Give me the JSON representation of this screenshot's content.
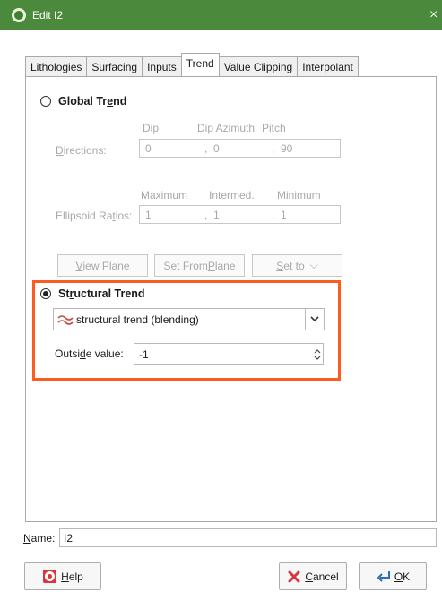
{
  "window": {
    "title": "Edit I2",
    "close_glyph": "×"
  },
  "tabs": [
    "Lithologies",
    "Surfacing",
    "Inputs",
    "Trend",
    "Value Clipping",
    "Interpolant"
  ],
  "active_tab": "Trend",
  "global_trend": {
    "label_pre": "Global Tr",
    "label_u": "e",
    "label_post": "nd",
    "directions": {
      "label_u": "D",
      "label_post": "irections:",
      "headers": [
        "Dip",
        "Dip Azimuth",
        "Pitch"
      ],
      "values": [
        "0",
        "0",
        "90"
      ],
      "sep": ","
    },
    "ellipsoid": {
      "label_pre": "Ellipsoid Ra",
      "label_u": "t",
      "label_post": "ios:",
      "headers": [
        "Maximum",
        "Intermed.",
        "Minimum"
      ],
      "values": [
        "1",
        "1",
        "1"
      ],
      "sep": ","
    },
    "buttons": {
      "view_plane_u": "V",
      "view_plane_post": "iew Plane",
      "set_from_plane_pre": "Set From ",
      "set_from_plane_u": "P",
      "set_from_plane_post": "lane",
      "set_to_u": "S",
      "set_to_post": "et to",
      "chevron": "⌵"
    }
  },
  "structural_trend": {
    "label_pre": "St",
    "label_u": "r",
    "label_post": "uctural Trend",
    "selected": "structural trend (blending)",
    "outside_label_pre": "Outsi",
    "outside_label_u": "d",
    "outside_label_post": "e value:",
    "outside_value": "-1"
  },
  "name": {
    "label_u": "N",
    "label_post": "ame:",
    "value": "I2"
  },
  "buttons": {
    "help_u": "H",
    "help_post": "elp",
    "cancel_u": "C",
    "cancel_post": "ancel",
    "ok_u": "O",
    "ok_post": "K"
  },
  "colors": {
    "titlebar": "#4b8a3c",
    "highlight": "#ff5a1f"
  }
}
